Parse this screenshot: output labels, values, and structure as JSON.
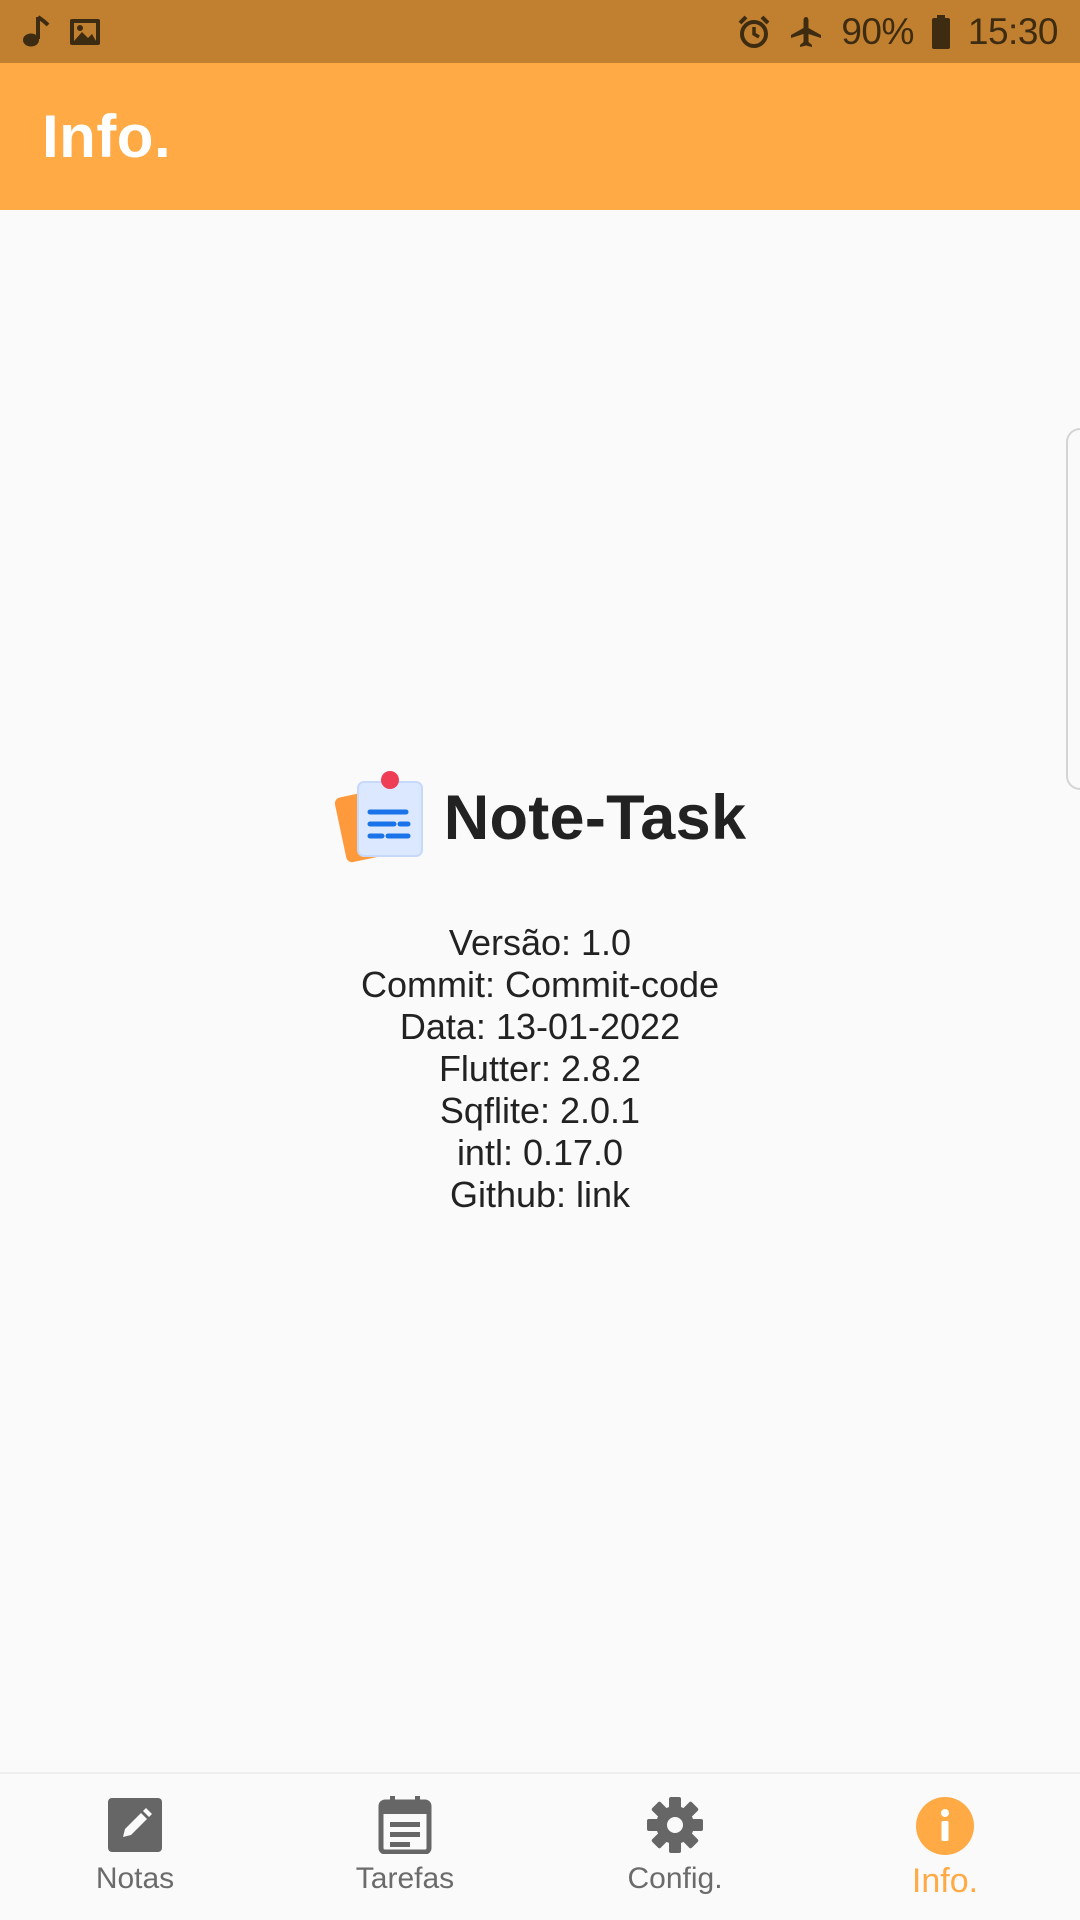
{
  "status_bar": {
    "battery": "90%",
    "time": "15:30",
    "left_icons": [
      "music-note-icon",
      "image-icon"
    ],
    "right_icons": [
      "alarm-icon",
      "airplane-icon",
      "battery-icon"
    ]
  },
  "app_bar": {
    "title": "Info."
  },
  "about": {
    "app_name": "Note-Task",
    "logo_icon": "notepad-icon",
    "lines": [
      "Versão: 1.0",
      "Commit: Commit-code",
      "Data: 13-01-2022",
      "Flutter: 2.8.2",
      "Sqflite: 2.0.1",
      "intl: 0.17.0",
      "Github: link"
    ]
  },
  "bottom_nav": {
    "items": [
      {
        "label": "Notas",
        "icon": "edit-note-icon"
      },
      {
        "label": "Tarefas",
        "icon": "calendar-icon"
      },
      {
        "label": "Config.",
        "icon": "gear-icon"
      },
      {
        "label": "Info.",
        "icon": "info-icon"
      }
    ],
    "active_index": 3
  },
  "colors": {
    "status_bar": "#c17f30",
    "accent": "#ffaa44",
    "inactive": "#6b6b6b",
    "text": "#222222",
    "background": "#fafafa"
  }
}
